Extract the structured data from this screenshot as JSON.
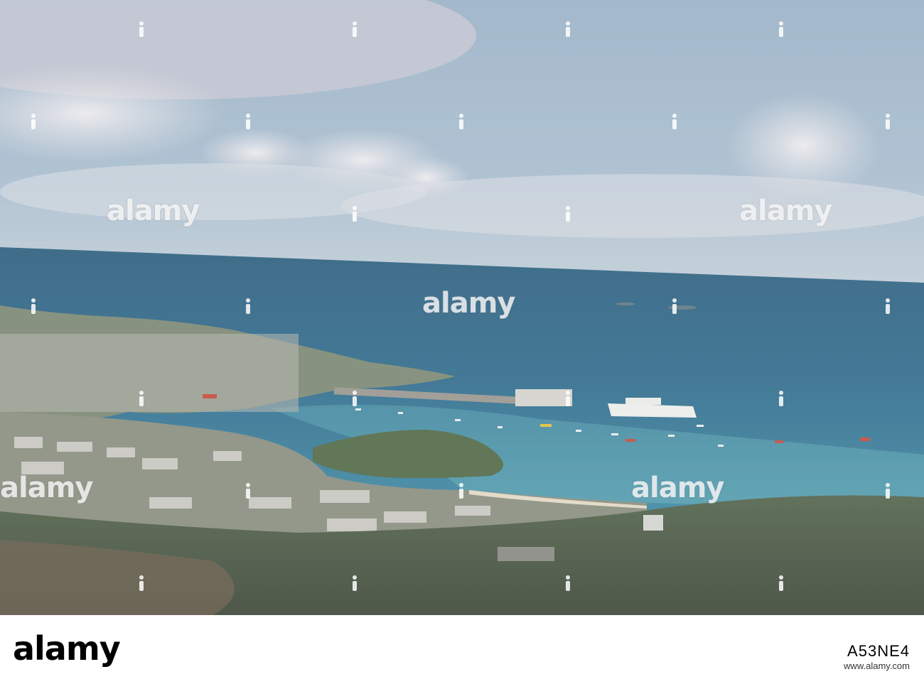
{
  "image": {
    "watermark_text": "alamy",
    "footer_logo": "alamy",
    "stock_id": "A53NE4",
    "footer_url": "www.alamy.com",
    "colors": {
      "sky_top": "#9fb7cc",
      "sky_horizon": "#b9cad5",
      "sea": "#2f6f8f",
      "land": "#4a5a42",
      "footer_bg": "#ffffff"
    }
  }
}
